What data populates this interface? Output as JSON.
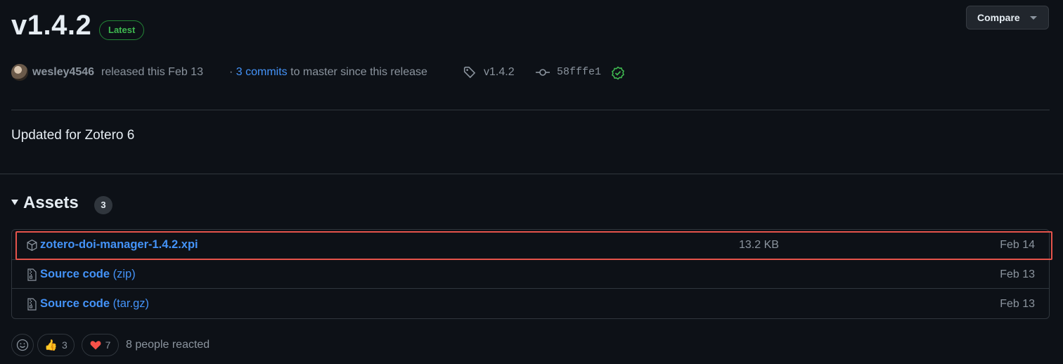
{
  "release": {
    "title": "v1.4.2",
    "badge": "Latest",
    "compare_label": "Compare",
    "author": "wesley4546",
    "released_text": "released this Feb 13",
    "commits_prefix": "·",
    "commits_link": "3 commits",
    "commits_suffix": "to master since this release",
    "tag": "v1.4.2",
    "commit_sha": "58fffe1",
    "body": "Updated for Zotero 6"
  },
  "assets": {
    "title": "Assets",
    "count": "3",
    "items": [
      {
        "name": "zotero-doi-manager-1.4.2.xpi",
        "suffix": "",
        "size": "13.2 KB",
        "date": "Feb 14",
        "icon": "package-icon"
      },
      {
        "name": "Source code",
        "suffix": "(zip)",
        "size": "",
        "date": "Feb 13",
        "icon": "file-zip-icon"
      },
      {
        "name": "Source code",
        "suffix": "(tar.gz)",
        "size": "",
        "date": "Feb 13",
        "icon": "file-zip-icon"
      }
    ]
  },
  "reactions": {
    "thumbs_up_count": "3",
    "heart_count": "7",
    "summary": "8 people reacted"
  },
  "colors": {
    "background": "#0d1117",
    "link": "#4493f8",
    "badge_green": "#3fb950",
    "highlight": "#e5534b"
  }
}
